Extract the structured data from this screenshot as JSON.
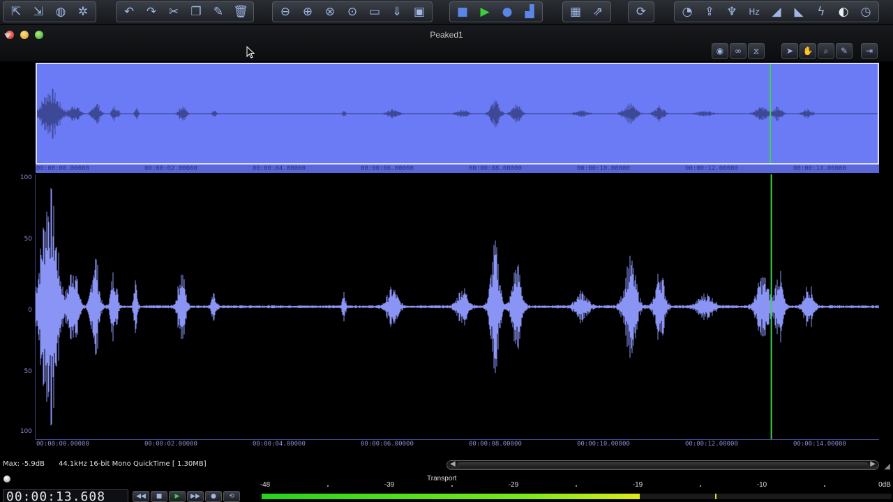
{
  "app": {
    "window_title": "Peaked1"
  },
  "toolbar": {
    "groups": [
      [
        "export-icon",
        "import-icon",
        "globe-icon",
        "network-icon"
      ],
      [
        "undo-icon",
        "redo-icon",
        "scissors-icon",
        "copy-icon",
        "paste-icon",
        "trash-icon"
      ],
      [
        "zoom-out-icon",
        "zoom-in-icon",
        "zoom-fit-icon",
        "zoom-selection-icon",
        "tape-icon",
        "down-arrow-icon",
        "monitor-icon"
      ],
      [
        "stop-icon",
        "play-icon",
        "record-icon",
        "meter-icon"
      ],
      [
        "grid-icon",
        "export-region-icon"
      ],
      [
        "loop-icon"
      ],
      [
        "spectrum-icon",
        "upload-icon",
        "microphone-icon",
        "hz-icon",
        "fade-in-icon",
        "fade-out-icon",
        "gain-icon",
        "contrast-icon",
        "dial-icon"
      ]
    ],
    "glyphs": {
      "export-icon": "⇱",
      "import-icon": "⇲",
      "globe-icon": "◍",
      "network-icon": "✲",
      "undo-icon": "↶",
      "redo-icon": "↷",
      "scissors-icon": "✂",
      "copy-icon": "❐",
      "paste-icon": "✎",
      "trash-icon": "🗑",
      "zoom-out-icon": "⊖",
      "zoom-in-icon": "⊕",
      "zoom-fit-icon": "⊗",
      "zoom-selection-icon": "⊙",
      "tape-icon": "▭",
      "down-arrow-icon": "⇓",
      "monitor-icon": "▣",
      "stop-icon": "■",
      "play-icon": "▶",
      "record-icon": "●",
      "meter-icon": "▟",
      "grid-icon": "▦",
      "export-region-icon": "⇗",
      "loop-icon": "⟳",
      "spectrum-icon": "◔",
      "upload-icon": "⇪",
      "microphone-icon": "♆",
      "hz-icon": "Hz",
      "fade-in-icon": "◢",
      "fade-out-icon": "◣",
      "gain-icon": "ϟ",
      "contrast-icon": "◐",
      "dial-icon": "◷"
    }
  },
  "right_tools": [
    {
      "name": "view-icon",
      "glyph": "◉"
    },
    {
      "name": "link-icon",
      "glyph": "∞"
    },
    {
      "name": "split-icon",
      "glyph": "⧖"
    },
    {
      "name": "pointer-tool-icon",
      "glyph": "➤"
    },
    {
      "name": "hand-tool-icon",
      "glyph": "✋"
    },
    {
      "name": "magnifier-tool-icon",
      "glyph": "⌕"
    },
    {
      "name": "pencil-tool-icon",
      "glyph": "✎"
    },
    {
      "name": "panel-toggle-icon",
      "glyph": "⇥"
    }
  ],
  "overview_ruler": [
    "00:00:00.00000",
    "00:00:02.00000",
    "00:00:04.00000",
    "00:00:06.00000",
    "00:00:08.00000",
    "00:00:10.00000",
    "00:00:12.00000",
    "00:00:14.00000"
  ],
  "time_ruler": [
    "00:00:00.00000",
    "00:00:02.00000",
    "00:00:04.00000",
    "00:00:06.00000",
    "00:00:08.00000",
    "00:00:10.00000",
    "00:00:12.00000",
    "00:00:14.00000"
  ],
  "amplitude_axis": [
    "100",
    "50",
    "0",
    "50",
    "100"
  ],
  "waveform": {
    "duration_s": 15.6,
    "playhead_s": 13.608,
    "wave_color": "#8a94f5",
    "playhead_color": "#3fd24a",
    "overview_bg": "#6a7bf5",
    "bursts": [
      {
        "t": 0.25,
        "amp": 0.95,
        "w": 0.28
      },
      {
        "t": 0.7,
        "amp": 0.35,
        "w": 0.15
      },
      {
        "t": 1.1,
        "amp": 0.45,
        "w": 0.12
      },
      {
        "t": 1.45,
        "amp": 0.3,
        "w": 0.1
      },
      {
        "t": 1.85,
        "amp": 0.2,
        "w": 0.06
      },
      {
        "t": 2.7,
        "amp": 0.3,
        "w": 0.12
      },
      {
        "t": 3.3,
        "amp": 0.1,
        "w": 0.08
      },
      {
        "t": 5.7,
        "amp": 0.15,
        "w": 0.05
      },
      {
        "t": 6.6,
        "amp": 0.15,
        "w": 0.18
      },
      {
        "t": 7.9,
        "amp": 0.15,
        "w": 0.18
      },
      {
        "t": 8.5,
        "amp": 0.5,
        "w": 0.15
      },
      {
        "t": 8.9,
        "amp": 0.35,
        "w": 0.15
      },
      {
        "t": 10.1,
        "amp": 0.12,
        "w": 0.2
      },
      {
        "t": 11.0,
        "amp": 0.38,
        "w": 0.2
      },
      {
        "t": 11.55,
        "amp": 0.3,
        "w": 0.15
      },
      {
        "t": 12.4,
        "amp": 0.1,
        "w": 0.25
      },
      {
        "t": 13.45,
        "amp": 0.25,
        "w": 0.2
      },
      {
        "t": 13.75,
        "amp": 0.3,
        "w": 0.12
      },
      {
        "t": 14.3,
        "amp": 0.18,
        "w": 0.15
      }
    ]
  },
  "status": {
    "max": "Max: -5.9dB",
    "format": "44.1kHz 16-bit Mono QuickTime [ 1.30MB]"
  },
  "transport": {
    "label": "Transport",
    "timecode": "00:00:13.608",
    "buttons": [
      {
        "name": "rewind-icon",
        "glyph": "◀◀"
      },
      {
        "name": "stop-icon",
        "glyph": "■"
      },
      {
        "name": "play-icon",
        "glyph": "▶"
      },
      {
        "name": "fast-forward-icon",
        "glyph": "▶▶"
      },
      {
        "name": "record-icon",
        "glyph": "●"
      },
      {
        "name": "loop-icon",
        "glyph": "⟲"
      }
    ]
  },
  "meter": {
    "labels": [
      "-48",
      "-39",
      "-29",
      "-19",
      "-10",
      "0dB"
    ],
    "level_fraction": 0.6,
    "peak_fraction": 0.72
  }
}
